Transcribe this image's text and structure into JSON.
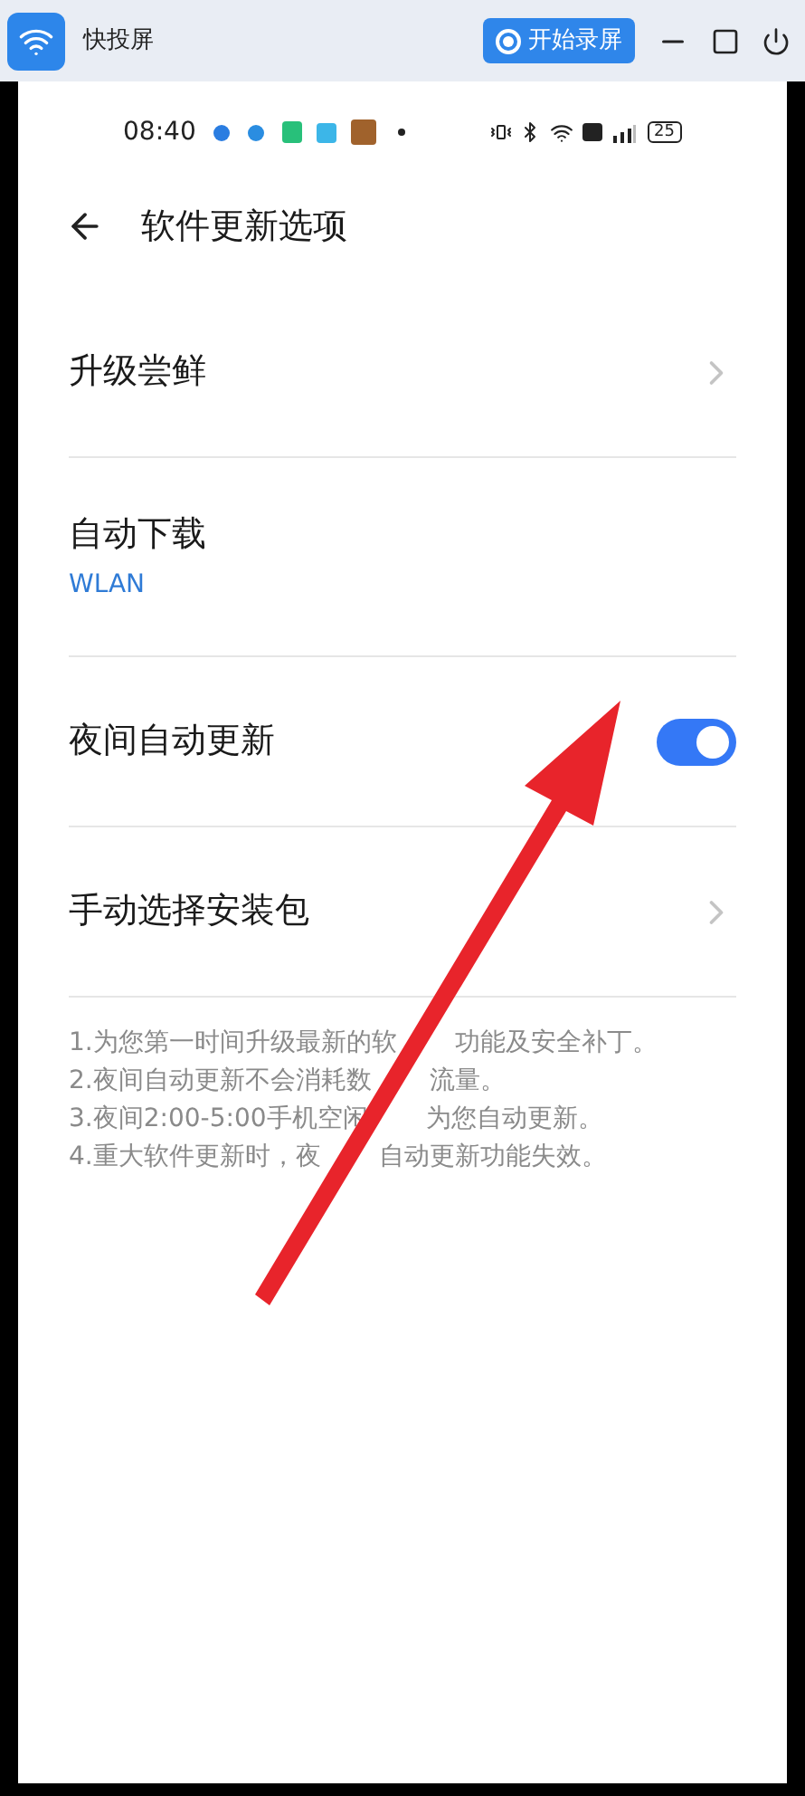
{
  "app": {
    "title": "快投屏",
    "record_button": "开始录屏"
  },
  "status_bar": {
    "time": "08:40",
    "battery": "25"
  },
  "header": {
    "title": "软件更新选项"
  },
  "settings": [
    {
      "kind": "link",
      "label": "升级尝鲜"
    },
    {
      "kind": "value",
      "label": "自动下载",
      "value": "WLAN"
    },
    {
      "kind": "toggle",
      "label": "夜间自动更新",
      "on": true
    },
    {
      "kind": "link",
      "label": "手动选择安装包"
    }
  ],
  "notes": [
    {
      "parts": [
        "1.为您第一时间升级最新的软",
        "功能及安全补丁。"
      ]
    },
    {
      "parts": [
        "2.夜间自动更新不会消耗数",
        "流量。"
      ]
    },
    {
      "parts": [
        "3.夜间2:00-5:00手机空闲",
        "为您自动更新。"
      ]
    },
    {
      "parts": [
        "4.重大软件更新时，夜",
        "自动更新功能失效。"
      ]
    }
  ]
}
